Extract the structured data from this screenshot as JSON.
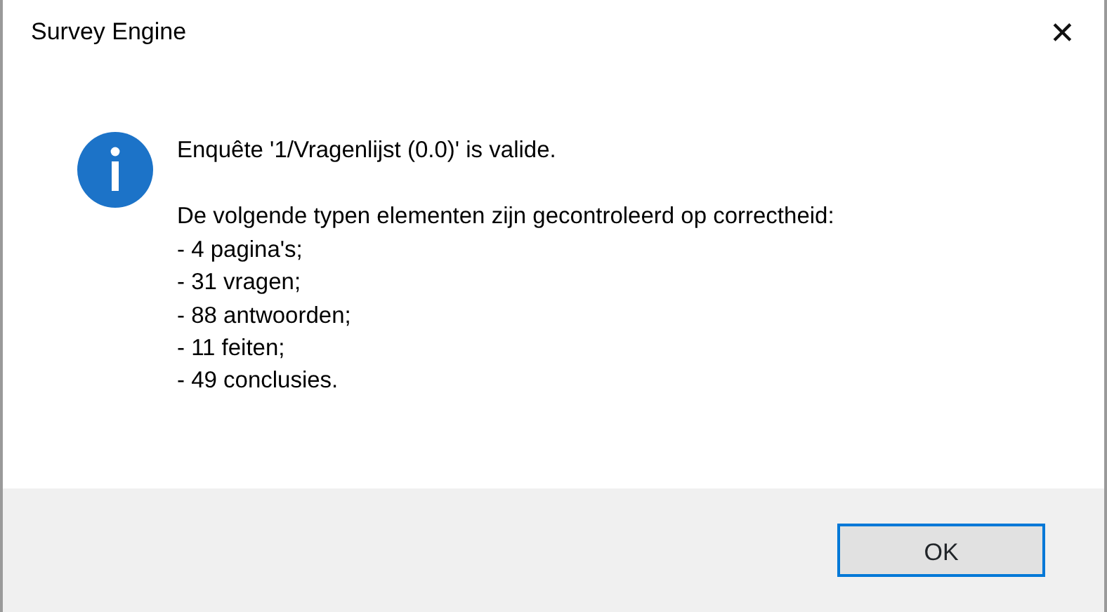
{
  "window": {
    "title": "Survey Engine",
    "close": "✕"
  },
  "message": {
    "headline": "Enquête '1/Vragenlijst (0.0)' is valide.",
    "intro": "De volgende typen elementen zijn gecontroleerd op correctheid:",
    "items": [
      "- 4 pagina's;",
      "- 31 vragen;",
      "- 88 antwoorden;",
      "- 11 feiten;",
      "- 49 conclusies."
    ]
  },
  "buttons": [
    {
      "label": "OK",
      "focused": true
    }
  ]
}
